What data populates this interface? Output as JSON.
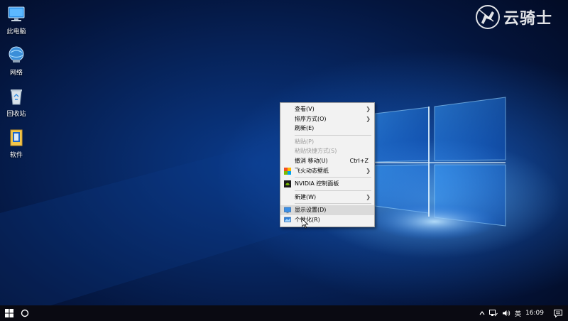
{
  "desktop_icons": [
    {
      "label": "此电脑",
      "icon": "this-pc-icon"
    },
    {
      "label": "网络",
      "icon": "network-icon"
    },
    {
      "label": "回收站",
      "icon": "recycle-bin-icon"
    },
    {
      "label": "软件",
      "icon": "software-folder-icon"
    }
  ],
  "watermark": {
    "text": "云骑士",
    "icon": "knight-logo-icon"
  },
  "context_menu": {
    "view": "查看(V)",
    "sort": "排序方式(O)",
    "refresh": "刷新(E)",
    "paste": "粘贴(P)",
    "paste_shortcut": "粘贴快捷方式(S)",
    "undo_move": "撤消 移动(U)",
    "undo_shortcut": "Ctrl+Z",
    "wallpaper": "飞火动态壁纸",
    "nvidia": "NVIDIA 控制面板",
    "new": "新建(W)",
    "display": "显示设置(D)",
    "personalize": "个性化(R)"
  },
  "taskbar": {
    "start_icon": "windows-start-icon",
    "search_icon": "cortana-circle-icon",
    "ime": "英",
    "time": "16:09"
  },
  "colors": {
    "menu_bg": "#f2f2f2",
    "menu_highlight": "#dadada",
    "disabled_text": "#9b9b9b",
    "taskbar_bg": "#0a0a12"
  }
}
